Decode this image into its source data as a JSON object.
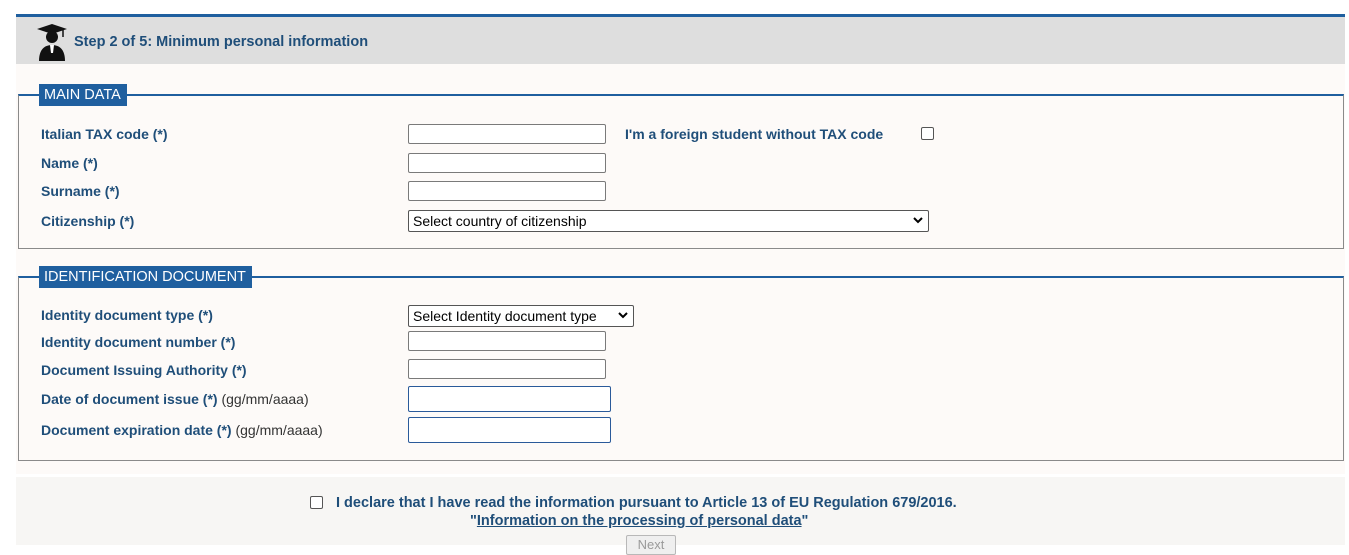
{
  "header": {
    "title": "Step 2 of 5: Minimum personal information",
    "icon": "graduate-student-icon"
  },
  "main_data": {
    "legend": "MAIN DATA",
    "tax_code_label": "Italian TAX code (*)",
    "foreign_label": "I'm a foreign student without TAX code",
    "foreign_checked": false,
    "name_label": "Name (*)",
    "surname_label": "Surname (*)",
    "citizenship_label": "Citizenship (*)",
    "citizenship_selected": "Select country of citizenship"
  },
  "identification": {
    "legend": "IDENTIFICATION DOCUMENT",
    "doc_type_label": "Identity document type (*)",
    "doc_type_selected": "Select Identity document type",
    "doc_number_label": "Identity document number (*)",
    "issuing_label": "Document Issuing Authority (*)",
    "issue_date_label": "Date of document issue (*)",
    "issue_date_hint": "(gg/mm/aaaa)",
    "expiry_label": "Document expiration date (*)",
    "expiry_hint": "(gg/mm/aaaa)"
  },
  "footer": {
    "declaration": "I declare that I have read the information pursuant to Article 13 of EU Regulation 679/2016.",
    "info_link": "Information on the processing of personal data",
    "quote_open": "\"",
    "quote_close": "\"",
    "next_label": "Next",
    "declaration_checked": false
  },
  "colors": {
    "primary": "#1f5f9f",
    "label_text": "#1f4e79"
  }
}
